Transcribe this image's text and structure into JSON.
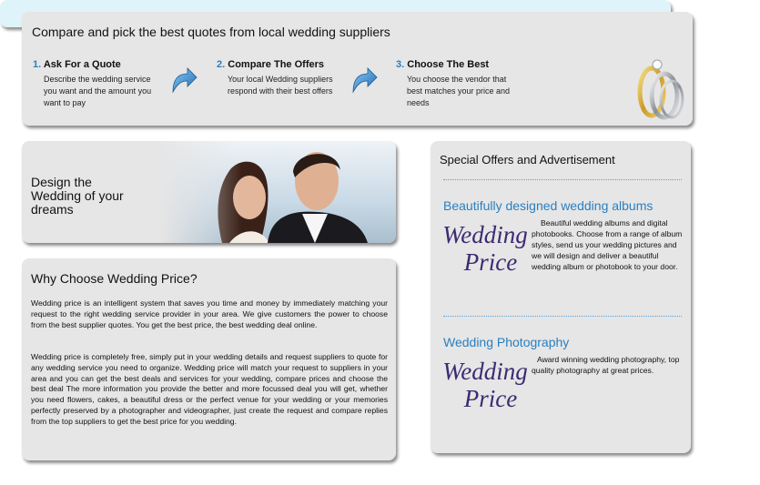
{
  "top": {
    "heading": "Compare and pick the best quotes from local wedding suppliers",
    "steps": [
      {
        "num": "1.",
        "title": "Ask For a Quote",
        "desc": "Describe the wedding service you want and the amount you want to pay"
      },
      {
        "num": "2.",
        "title": "Compare The Offers",
        "desc": "Your local Wedding suppliers respond with their best offers"
      },
      {
        "num": "3.",
        "title": "Choose The Best",
        "desc": "You choose the vendor that best matches your price and needs"
      }
    ],
    "arrow_icon": "curved-arrow-icon",
    "rings_icon": "wedding-rings-icon"
  },
  "banner": {
    "text": "Design the Wedding of your dreams"
  },
  "why": {
    "title": "Why Choose Wedding Price?",
    "p1": "Wedding price is an intelligent system that saves you time and money by immediately matching your request to the right wedding service provider in your area. We give customers the power to choose from the best supplier quotes. You get the best price, the best wedding deal online.",
    "p2": "Wedding price is completely free, simply put in your wedding details and request suppliers to quote for any wedding service you need to organize. Wedding price will match your request to suppliers in your area and you can get the best deals and services for your wedding, compare prices and choose the best deal The more information you provide the better and more focussed deal you will get, whether you need flowers, cakes, a beautiful dress or the perfect venue for your wedding or your memories perfectly preserved by a photographer and videographer, just create the request and compare replies from the top suppliers to get the best price for you wedding."
  },
  "offers": {
    "title": "Special Offers and Advertisement",
    "items": [
      {
        "title": "Beautifully designed wedding albums",
        "logo_line1": "Wedding",
        "logo_line2": "Price",
        "text": "Beautiful wedding albums and digital photobooks. Choose from a range of album styles, send us your wedding pictures and we will design and deliver a beautiful wedding album or photobook to your door."
      },
      {
        "title": "Wedding Photography",
        "logo_line1": "Wedding",
        "logo_line2": "Price",
        "text": "Award winning wedding photography, top quality photography at great prices."
      }
    ]
  },
  "colors": {
    "accent_blue": "#2a7fc0",
    "panel_gray": "#e6e6e6",
    "logo_purple": "#3d2a72"
  }
}
